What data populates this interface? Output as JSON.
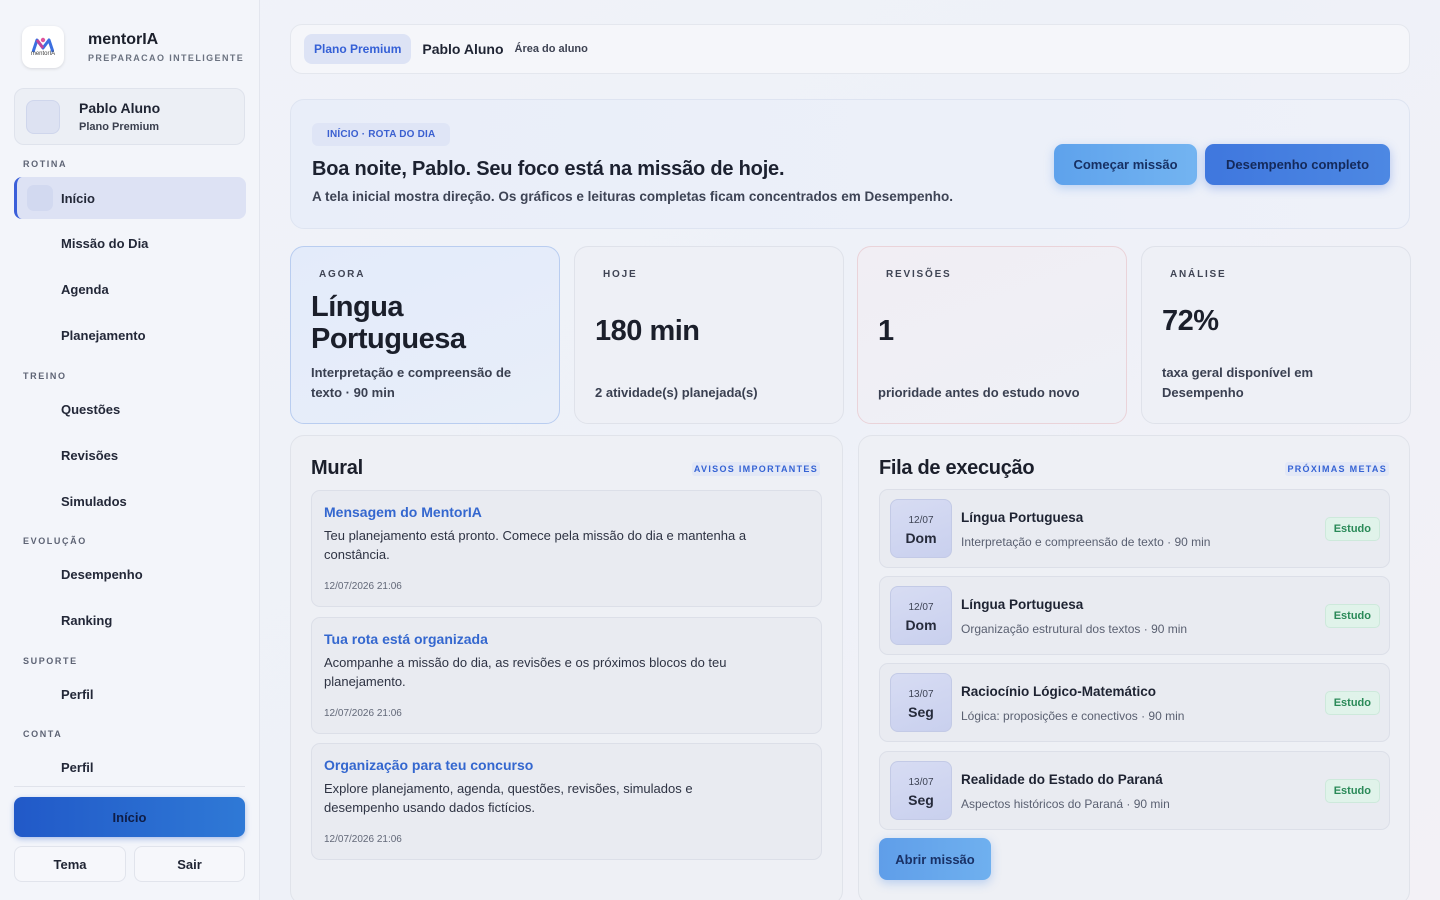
{
  "brand": {
    "name": "mentorIA",
    "tagline": "PREPARACAO INTELIGENTE",
    "logo_caption": "mentorIA"
  },
  "user": {
    "name": "Pablo Aluno",
    "plan": "Plano Premium"
  },
  "sidebar": {
    "sections": [
      "ROTINA",
      "TREINO",
      "EVOLUÇÃO",
      "SUPORTE",
      "CONTA"
    ],
    "items": [
      {
        "label": "Início",
        "active": true
      },
      {
        "label": "Missão do Dia"
      },
      {
        "label": "Agenda"
      },
      {
        "label": "Planejamento"
      },
      {
        "label": "Questões"
      },
      {
        "label": "Revisões"
      },
      {
        "label": "Simulados"
      },
      {
        "label": "Desempenho"
      },
      {
        "label": "Ranking"
      },
      {
        "label": "Perfil"
      },
      {
        "label": "Perfil"
      }
    ],
    "primary_button": "Início",
    "theme_button": "Tema",
    "logout_button": "Sair"
  },
  "topbar": {
    "plan": "Plano Premium",
    "name": "Pablo Aluno",
    "area": "Área do aluno"
  },
  "hero": {
    "chip": "INÍCIO · ROTA DO DIA",
    "title": "Boa noite, Pablo. Seu foco está na missão de hoje.",
    "subtitle": "A tela inicial mostra direção. Os gráficos e leituras completas ficam concentrados em Desempenho.",
    "start_button": "Começar missão",
    "performance_button": "Desempenho completo"
  },
  "stats": [
    {
      "label": "AGORA",
      "value": "Língua Portuguesa",
      "desc": "Interpretação e compreensão de texto · 90 min"
    },
    {
      "label": "HOJE",
      "value": "180 min",
      "desc": "2 atividade(s) planejada(s)"
    },
    {
      "label": "REVISÕES",
      "value": "1",
      "desc": "prioridade antes do estudo novo"
    },
    {
      "label": "ANÁLISE",
      "value": "72%",
      "desc": "taxa geral disponível em Desempenho"
    }
  ],
  "mural": {
    "title": "Mural",
    "tag": "AVISOS IMPORTANTES",
    "messages": [
      {
        "title": "Mensagem do MentorIA",
        "body": "Teu planejamento está pronto. Comece pela missão do dia e mantenha a constância.",
        "date": "12/07/2026 21:06"
      },
      {
        "title": "Tua rota está organizada",
        "body": "Acompanhe a missão do dia, as revisões e os próximos blocos do teu planejamento.",
        "date": "12/07/2026 21:06"
      },
      {
        "title": "Organização para teu concurso",
        "body": "Explore planejamento, agenda, questões, revisões, simulados e desempenho usando dados fictícios.",
        "date": "12/07/2026 21:06"
      }
    ]
  },
  "queue": {
    "title": "Fila de execução",
    "tag": "PRÓXIMAS METAS",
    "items": [
      {
        "date": "12/07",
        "weekday": "Dom",
        "title": "Língua Portuguesa",
        "sub": "Interpretação e compreensão de texto · 90 min",
        "badge": "Estudo"
      },
      {
        "date": "12/07",
        "weekday": "Dom",
        "title": "Língua Portuguesa",
        "sub": "Organização estrutural dos textos · 90 min",
        "badge": "Estudo"
      },
      {
        "date": "13/07",
        "weekday": "Seg",
        "title": "Raciocínio Lógico-Matemático",
        "sub": "Lógica: proposições e conectivos · 90 min",
        "badge": "Estudo"
      },
      {
        "date": "13/07",
        "weekday": "Seg",
        "title": "Realidade do Estado do Paraná",
        "sub": "Aspectos históricos do Paraná · 90 min",
        "badge": "Estudo"
      }
    ],
    "open_button": "Abrir missão"
  }
}
